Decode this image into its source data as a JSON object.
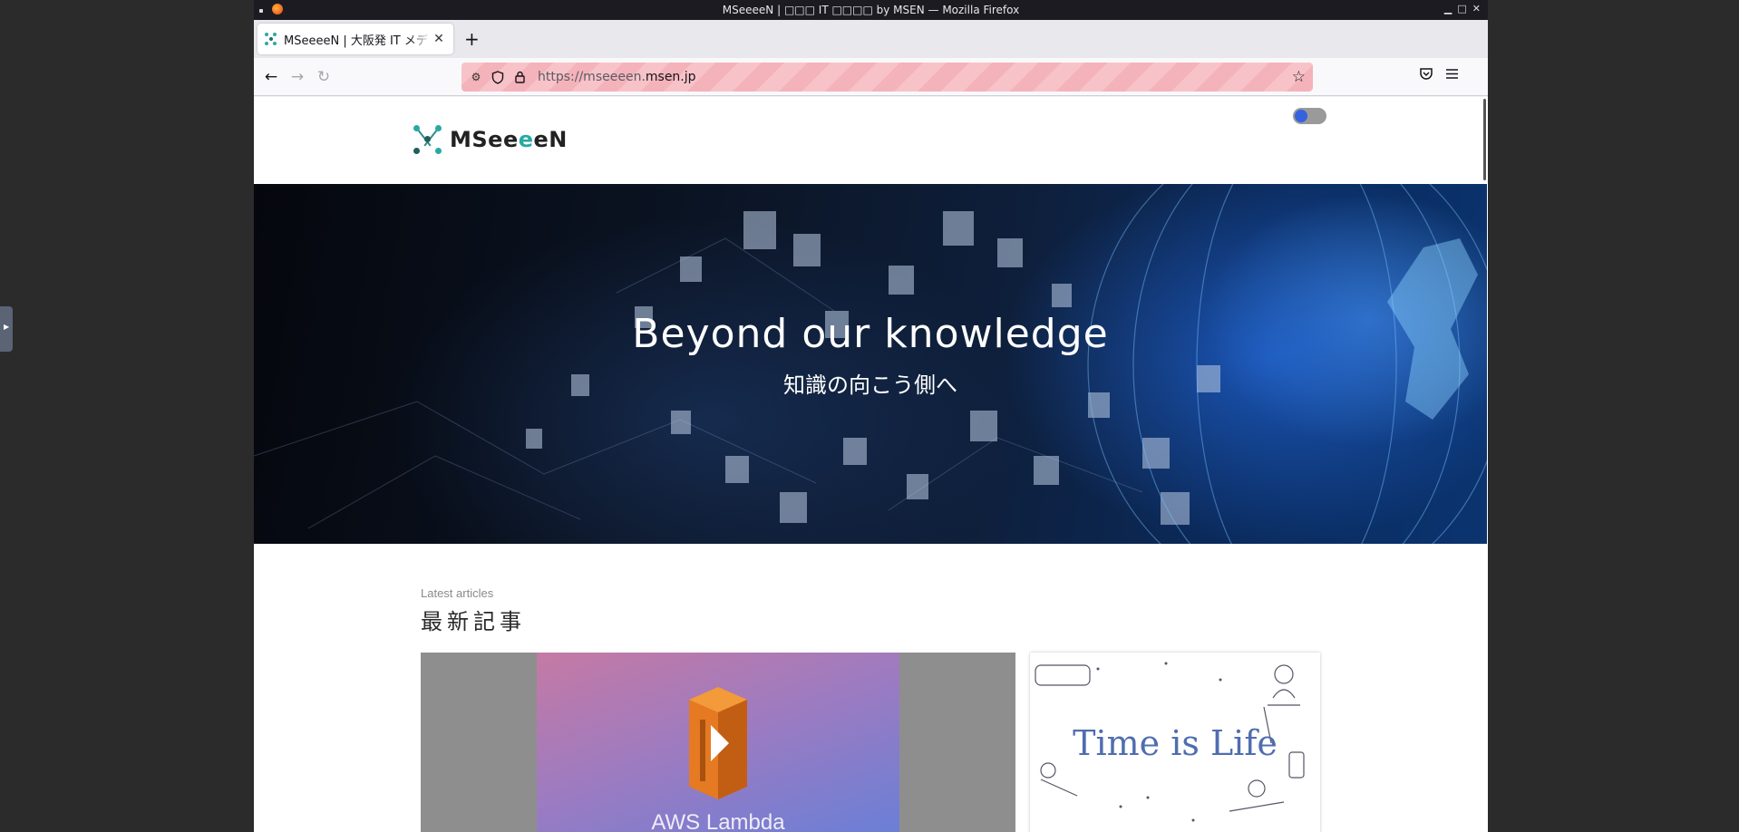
{
  "window": {
    "title": "MSeeeeN | □□□ IT □□□□ by MSEN — Mozilla Firefox"
  },
  "browser": {
    "tab_title": "MSeeeeN | 大阪発 IT メデ",
    "new_tab_label": "+",
    "url_prefix": "https://mseeeen.",
    "url_domain": "msen.jp",
    "icons": [
      "back-icon",
      "forward-icon",
      "reload-icon",
      "shield-icon",
      "lock-icon",
      "star-icon",
      "pocket-icon",
      "menu-icon"
    ]
  },
  "site": {
    "logo_text_prefix": "MSee",
    "logo_text_accent": "e",
    "logo_text_suffix": "eN",
    "theme_toggle_state": "dark",
    "hero_title": "Beyond our knowledge",
    "hero_subtitle": "知識の向こう側へ",
    "latest_label_en": "Latest articles",
    "latest_label_jp": "最新記事",
    "article_1_image_text": "AWS Lambda",
    "article_2_image_text": "Time is Life"
  },
  "colors": {
    "accent": "#27aaa3",
    "toggle_knob": "#3463e0",
    "url_bar_stripe": "#f8c3c8"
  }
}
